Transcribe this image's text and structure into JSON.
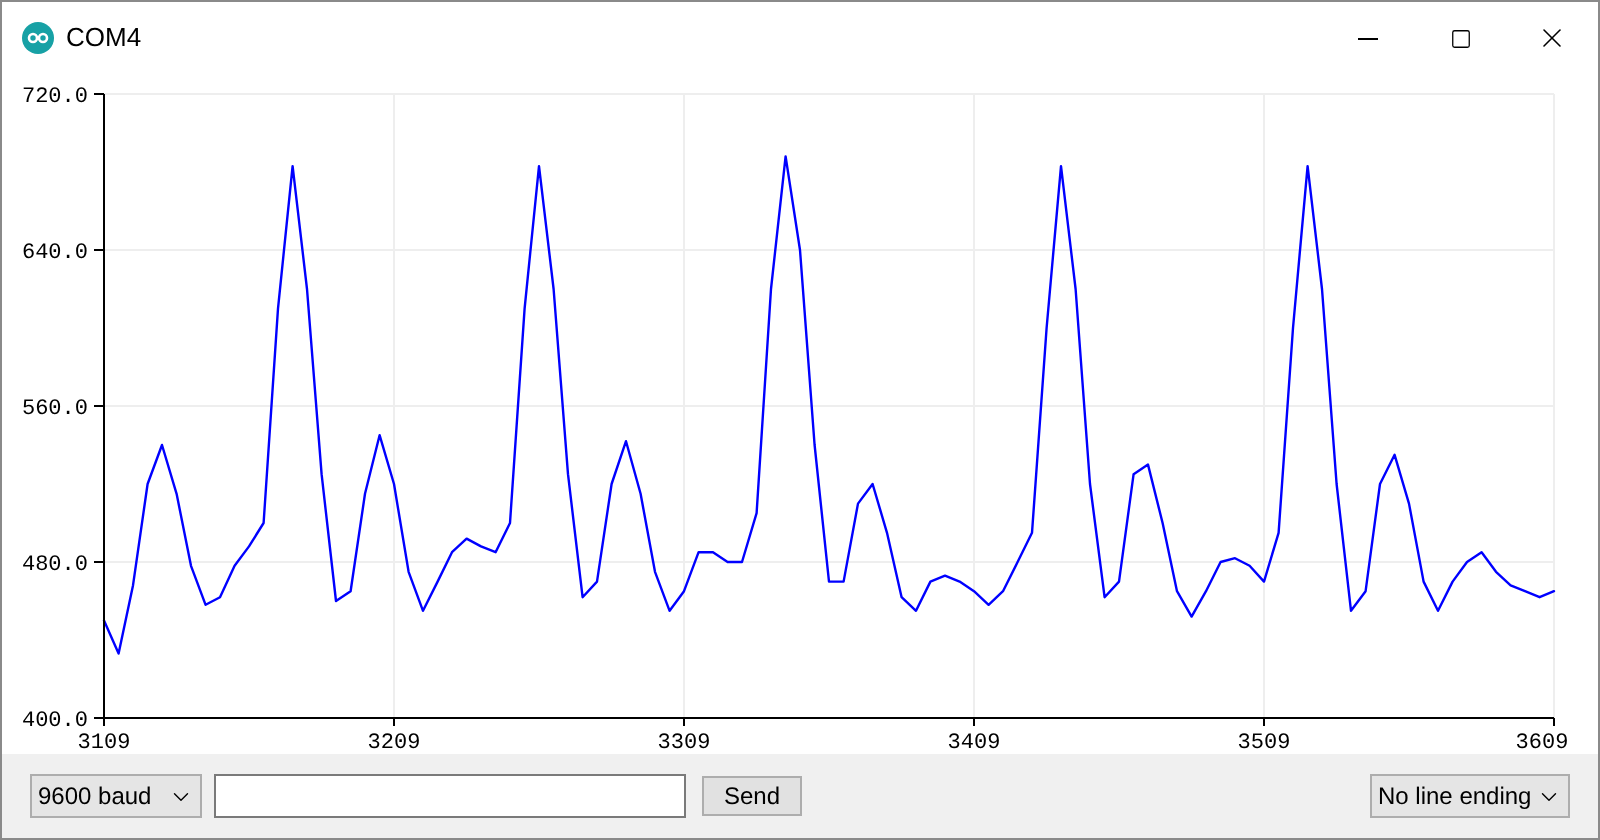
{
  "window": {
    "title": "COM4"
  },
  "plot": {
    "chart_data": {
      "type": "line",
      "x": [
        3109,
        3114,
        3119,
        3124,
        3129,
        3134,
        3139,
        3144,
        3149,
        3154,
        3159,
        3164,
        3169,
        3174,
        3179,
        3184,
        3189,
        3194,
        3199,
        3204,
        3209,
        3214,
        3219,
        3224,
        3229,
        3234,
        3239,
        3244,
        3249,
        3254,
        3259,
        3264,
        3269,
        3274,
        3279,
        3284,
        3289,
        3294,
        3299,
        3304,
        3309,
        3314,
        3319,
        3324,
        3329,
        3334,
        3339,
        3344,
        3349,
        3354,
        3359,
        3364,
        3369,
        3374,
        3379,
        3384,
        3389,
        3394,
        3399,
        3404,
        3409,
        3414,
        3419,
        3424,
        3429,
        3434,
        3439,
        3444,
        3449,
        3454,
        3459,
        3464,
        3469,
        3474,
        3479,
        3484,
        3489,
        3494,
        3499,
        3504,
        3509,
        3514,
        3519,
        3524,
        3529,
        3534,
        3539,
        3544,
        3549,
        3554,
        3559,
        3564,
        3569,
        3574,
        3579,
        3584,
        3589,
        3594,
        3599,
        3604,
        3609
      ],
      "series": [
        {
          "color": "#0000ff",
          "values": [
            450,
            433,
            468,
            520,
            540,
            515,
            478,
            458,
            462,
            478,
            488,
            500,
            610,
            683,
            620,
            525,
            460,
            465,
            515,
            545,
            520,
            475,
            455,
            470,
            485,
            492,
            488,
            485,
            500,
            610,
            683,
            620,
            525,
            462,
            470,
            520,
            542,
            515,
            475,
            455,
            465,
            485,
            485,
            480,
            480,
            505,
            620,
            688,
            640,
            540,
            470,
            470,
            510,
            520,
            495,
            462,
            455,
            470,
            473,
            470,
            465,
            458,
            465,
            480,
            495,
            600,
            683,
            620,
            520,
            462,
            470,
            525,
            530,
            500,
            465,
            452,
            465,
            480,
            482,
            478,
            470,
            495,
            600,
            683,
            620,
            520,
            455,
            465,
            520,
            535,
            510,
            470,
            455,
            470,
            480,
            485,
            475,
            468,
            465,
            462,
            465
          ]
        }
      ],
      "grid": true,
      "xlim": [
        3109,
        3609
      ],
      "ylim": [
        400,
        720
      ],
      "xticks": [
        3109,
        3209,
        3309,
        3409,
        3509,
        3609
      ],
      "yticks": [
        {
          "value": 400,
          "label": "400.0"
        },
        {
          "value": 480,
          "label": "480.0"
        },
        {
          "value": 560,
          "label": "560.0"
        },
        {
          "value": 640,
          "label": "640.0"
        },
        {
          "value": 720,
          "label": "720.0"
        }
      ]
    }
  },
  "controls": {
    "baud_rate": "9600 baud",
    "send_button": "Send",
    "line_ending": "No line ending"
  }
}
